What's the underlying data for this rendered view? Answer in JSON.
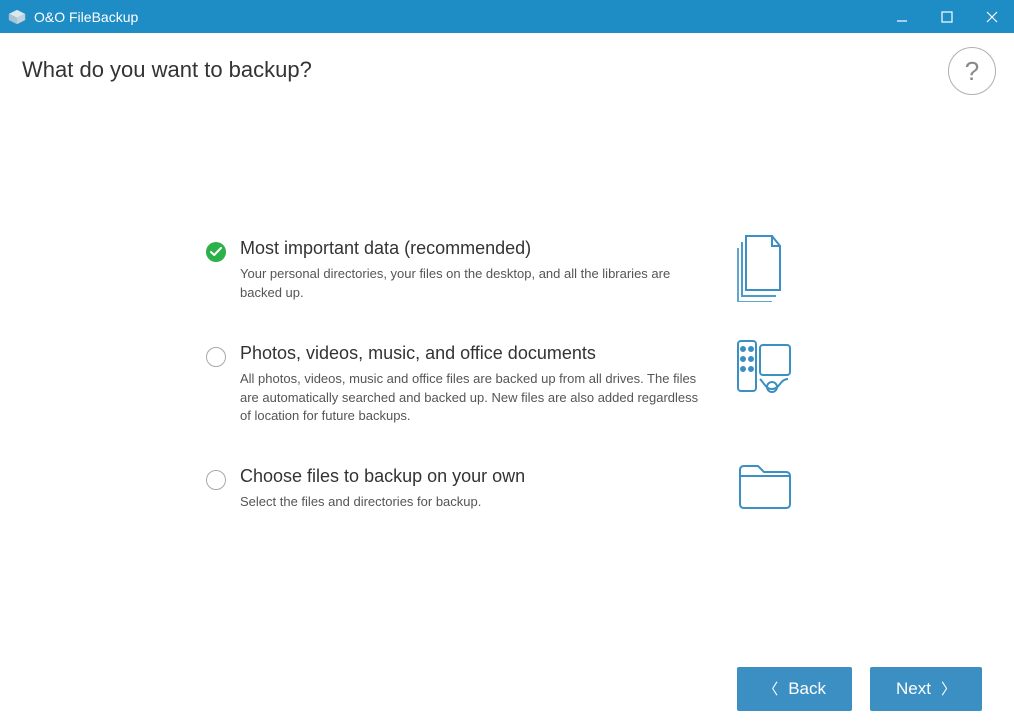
{
  "titlebar": {
    "title": "O&O FileBackup"
  },
  "page": {
    "title": "What do you want to backup?"
  },
  "options": [
    {
      "title": "Most important data (recommended)",
      "description": "Your personal directories, your files on the desktop, and all the libraries are backed up.",
      "selected": true,
      "icon": "files-icon"
    },
    {
      "title": "Photos, videos, music, and office documents",
      "description": "All photos, videos, music and office files are backed up from all drives. The files are automatically searched and backed up. New files are also added regardless of location for future backups.",
      "selected": false,
      "icon": "media-icon"
    },
    {
      "title": "Choose files to backup on your own",
      "description": "Select the files and directories for backup.",
      "selected": false,
      "icon": "folder-icon"
    }
  ],
  "footer": {
    "back_label": "Back",
    "next_label": "Next"
  }
}
